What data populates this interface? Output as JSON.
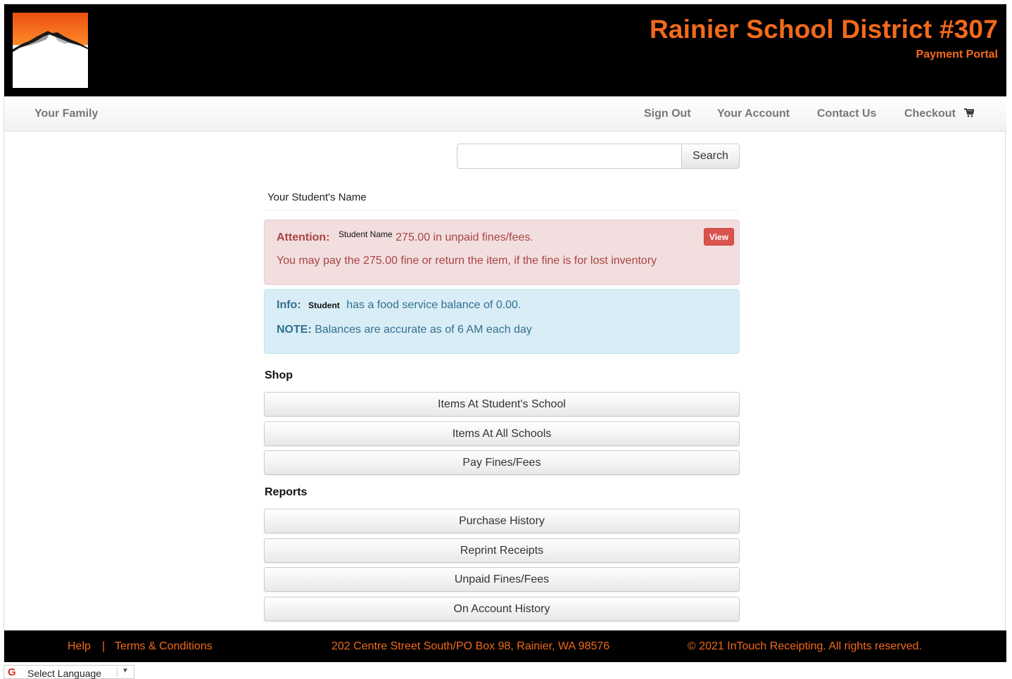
{
  "header": {
    "title": "Rainier School District #307",
    "subtitle": "Payment Portal"
  },
  "nav": {
    "family": "Your Family",
    "sign_out": "Sign Out",
    "your_account": "Your Account",
    "contact_us": "Contact Us",
    "checkout": "Checkout"
  },
  "search": {
    "value": "",
    "placeholder": "",
    "button": "Search"
  },
  "student_heading": "Your Student's Name",
  "attention_alert": {
    "label": "Attention:",
    "name": "Student Name",
    "text": "275.00 in unpaid fines/fees.",
    "line2": "You may pay the 275.00 fine or return the item, if the fine is for lost inventory",
    "view_button": "View"
  },
  "info_alert": {
    "label": "Info:",
    "name": "Student",
    "text": "has a food service balance of 0.00.",
    "note_label": "NOTE:",
    "note_text": "Balances are accurate as of 6 AM each day"
  },
  "shop": {
    "title": "Shop",
    "items": [
      "Items At Student's School",
      "Items At All Schools",
      "Pay Fines/Fees"
    ]
  },
  "reports": {
    "title": "Reports",
    "items": [
      "Purchase History",
      "Reprint Receipts",
      "Unpaid Fines/Fees",
      "On Account History"
    ]
  },
  "footer": {
    "help": "Help",
    "separator": "|",
    "terms": "Terms & Conditions",
    "address": "202 Centre Street South/PO Box 98, Rainier, WA 98576",
    "copyright": "© 2021 InTouch Receipting. All rights reserved."
  },
  "language": {
    "label": "Select Language"
  },
  "colors": {
    "brand_orange": "#f26a1b",
    "header_black": "#000000",
    "danger_bg": "#f2dede",
    "info_bg": "#d9edf7"
  }
}
